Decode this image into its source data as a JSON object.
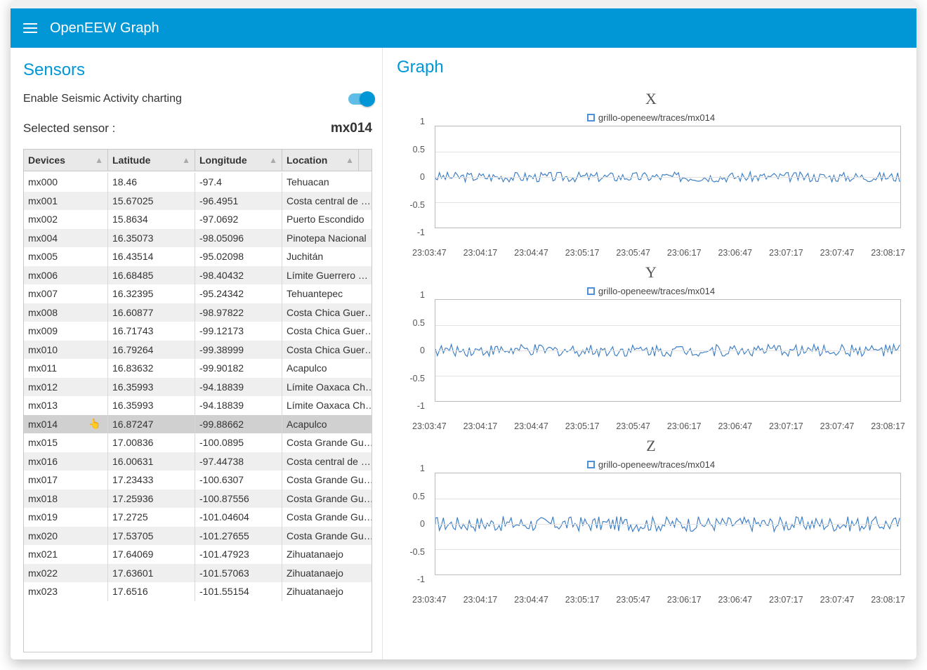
{
  "header": {
    "title": "OpenEEW Graph"
  },
  "sensors": {
    "title": "Sensors",
    "toggle_label": "Enable Seismic Activity charting",
    "toggle_on": true,
    "selected_label": "Selected sensor :",
    "selected_value": "mx014",
    "columns": [
      "Devices",
      "Latitude",
      "Longitude",
      "Location"
    ],
    "selected_row_id": "mx014",
    "rows": [
      {
        "device": "mx000",
        "lat": "18.46",
        "lon": "-97.4",
        "loc": "Tehuacan"
      },
      {
        "device": "mx001",
        "lat": "15.67025",
        "lon": "-96.4951",
        "loc": "Costa central de …"
      },
      {
        "device": "mx002",
        "lat": "15.8634",
        "lon": "-97.0692",
        "loc": "Puerto Escondido"
      },
      {
        "device": "mx004",
        "lat": "16.35073",
        "lon": "-98.05096",
        "loc": "Pinotepa Nacional"
      },
      {
        "device": "mx005",
        "lat": "16.43514",
        "lon": "-95.02098",
        "loc": "Juchitán"
      },
      {
        "device": "mx006",
        "lat": "16.68485",
        "lon": "-98.40432",
        "loc": "Límite Guerrero …"
      },
      {
        "device": "mx007",
        "lat": "16.32395",
        "lon": "-95.24342",
        "loc": "Tehuantepec"
      },
      {
        "device": "mx008",
        "lat": "16.60877",
        "lon": "-98.97822",
        "loc": "Costa Chica Guer…"
      },
      {
        "device": "mx009",
        "lat": "16.71743",
        "lon": "-99.12173",
        "loc": "Costa Chica Guer…"
      },
      {
        "device": "mx010",
        "lat": "16.79264",
        "lon": "-99.38999",
        "loc": "Costa Chica Guer…"
      },
      {
        "device": "mx011",
        "lat": "16.83632",
        "lon": "-99.90182",
        "loc": "Acapulco"
      },
      {
        "device": "mx012",
        "lat": "16.35993",
        "lon": "-94.18839",
        "loc": "Límite Oaxaca Ch…"
      },
      {
        "device": "mx013",
        "lat": "16.35993",
        "lon": "-94.18839",
        "loc": "Límite Oaxaca Ch…"
      },
      {
        "device": "mx014",
        "lat": "16.87247",
        "lon": "-99.88662",
        "loc": "Acapulco"
      },
      {
        "device": "mx015",
        "lat": "17.00836",
        "lon": "-100.0895",
        "loc": "Costa Grande Gu…"
      },
      {
        "device": "mx016",
        "lat": "16.00631",
        "lon": "-97.44738",
        "loc": "Costa central de …"
      },
      {
        "device": "mx017",
        "lat": "17.23433",
        "lon": "-100.6307",
        "loc": "Costa Grande Gu…"
      },
      {
        "device": "mx018",
        "lat": "17.25936",
        "lon": "-100.87556",
        "loc": "Costa Grande Gu…"
      },
      {
        "device": "mx019",
        "lat": "17.2725",
        "lon": "-101.04604",
        "loc": "Costa Grande Gu…"
      },
      {
        "device": "mx020",
        "lat": "17.53705",
        "lon": "-101.27655",
        "loc": "Costa Grande Gu…"
      },
      {
        "device": "mx021",
        "lat": "17.64069",
        "lon": "-101.47923",
        "loc": "Zihuatanaejo"
      },
      {
        "device": "mx022",
        "lat": "17.63601",
        "lon": "-101.57063",
        "loc": "Zihuatanaejo"
      },
      {
        "device": "mx023",
        "lat": "17.6516",
        "lon": "-101.55154",
        "loc": "Zihuatanaejo"
      }
    ]
  },
  "graph": {
    "title": "Graph",
    "legend_series": "grillo-openeew/traces/mx014",
    "y_ticks": [
      "1",
      "0.5",
      "0",
      "-0.5",
      "-1"
    ],
    "x_ticks": [
      "23:03:47",
      "23:04:17",
      "23:04:47",
      "23:05:17",
      "23:05:47",
      "23:06:17",
      "23:06:47",
      "23:07:17",
      "23:07:47",
      "23:08:17"
    ],
    "charts": [
      "X",
      "Y",
      "Z"
    ]
  },
  "chart_data": [
    {
      "type": "line",
      "title": "X",
      "series": [
        {
          "name": "grillo-openeew/traces/mx014"
        }
      ],
      "x_categories": [
        "23:03:47",
        "23:04:17",
        "23:04:47",
        "23:05:17",
        "23:05:47",
        "23:06:17",
        "23:06:47",
        "23:07:17",
        "23:07:47",
        "23:08:17"
      ],
      "ylim": [
        -1,
        1
      ],
      "y_ticks": [
        1,
        0.5,
        0,
        -0.5,
        -1
      ],
      "note": "noisy trace ~0 baseline, amplitude approx ±0.1"
    },
    {
      "type": "line",
      "title": "Y",
      "series": [
        {
          "name": "grillo-openeew/traces/mx014"
        }
      ],
      "x_categories": [
        "23:03:47",
        "23:04:17",
        "23:04:47",
        "23:05:17",
        "23:05:47",
        "23:06:17",
        "23:06:47",
        "23:07:17",
        "23:07:47",
        "23:08:17"
      ],
      "ylim": [
        -1,
        1
      ],
      "y_ticks": [
        1,
        0.5,
        0,
        -0.5,
        -1
      ],
      "note": "noisy trace ~0 baseline, amplitude approx ±0.12"
    },
    {
      "type": "line",
      "title": "Z",
      "series": [
        {
          "name": "grillo-openeew/traces/mx014"
        }
      ],
      "x_categories": [
        "23:03:47",
        "23:04:17",
        "23:04:47",
        "23:05:17",
        "23:05:47",
        "23:06:17",
        "23:06:47",
        "23:07:17",
        "23:07:47",
        "23:08:17"
      ],
      "ylim": [
        -1,
        1
      ],
      "y_ticks": [
        1,
        0.5,
        0,
        -0.5,
        -1
      ],
      "note": "noisy trace ~0 baseline, amplitude approx ±0.15"
    }
  ]
}
